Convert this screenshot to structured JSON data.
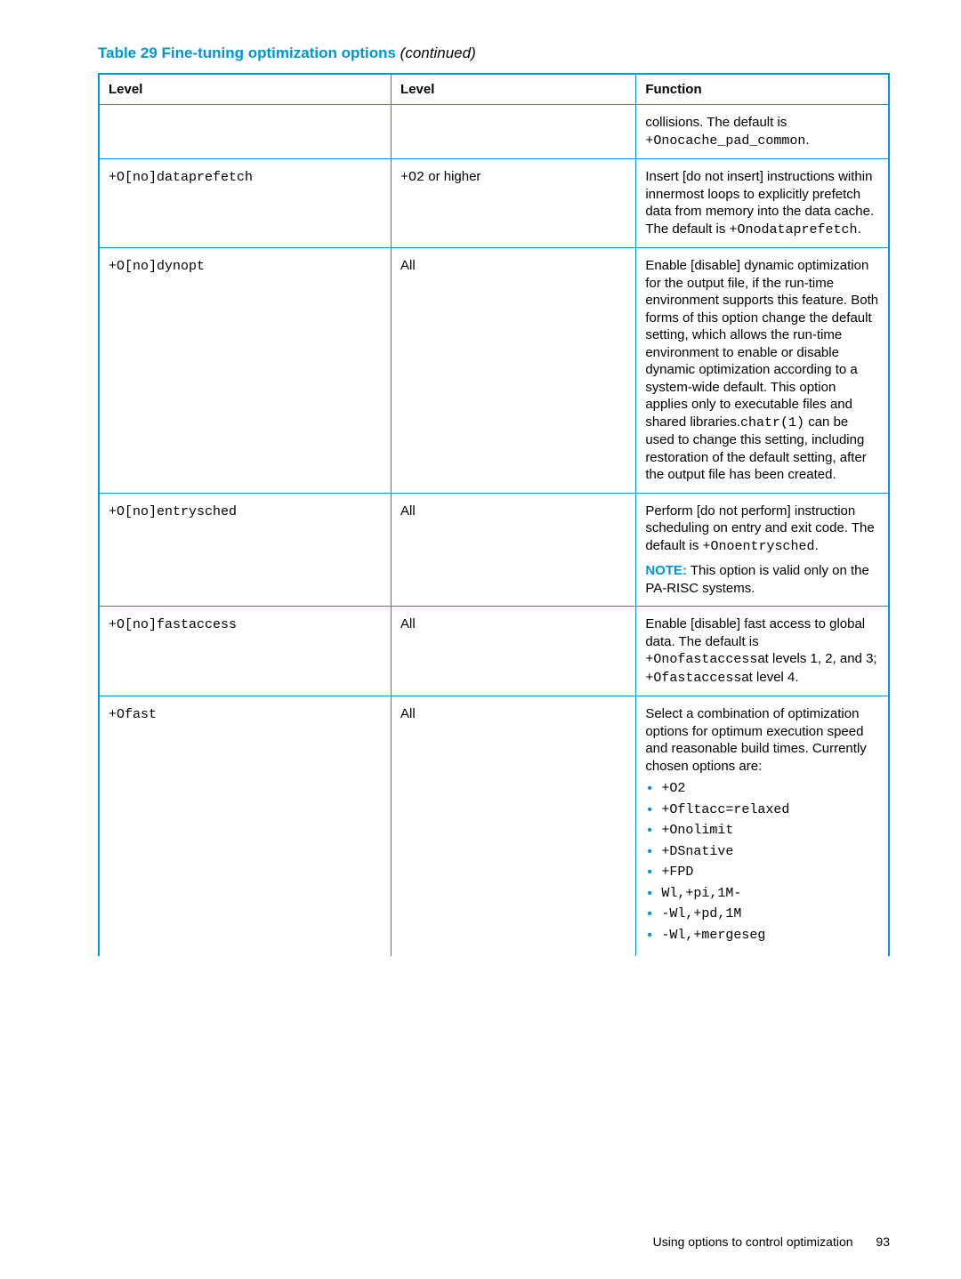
{
  "caption": {
    "prefix": "Table 29 Fine-tuning optimization options",
    "suffix": " (continued)"
  },
  "headers": {
    "c1": "Level",
    "c2": "Level",
    "c3": "Function"
  },
  "rows": {
    "r0": {
      "col1": "",
      "col2": "",
      "col3_a": "collisions. The default is ",
      "col3_code": "+Onocache_pad_common",
      "col3_b": "."
    },
    "r1": {
      "col1": "+O[no]dataprefetch",
      "col2_a": "+O2",
      "col2_b": " or higher",
      "col3_a": "Insert [do not insert] instructions within innermost loops to explicitly prefetch data from memory into the data cache. The default is ",
      "col3_code": "+Onodataprefetch",
      "col3_b": "."
    },
    "r2": {
      "col1": "+O[no]dynopt",
      "col2": "All",
      "col3_a": "Enable [disable] dynamic optimization for the output file, if the run-time environment supports this feature. Both forms of this option change the default setting, which allows the run-time environment to enable or disable dynamic optimization according to a system-wide default. This option applies only to executable files and shared libraries.",
      "col3_code": "chatr(1)",
      "col3_b": " can be used to change this setting, including restoration of the default setting, after the output file has been created."
    },
    "r3": {
      "col1": "+O[no]entrysched",
      "col2": "All",
      "col3_a": "Perform [do not perform] instruction scheduling on entry and exit code. The default is ",
      "col3_code": "+Onoentrysched",
      "col3_b": ".",
      "note_label": "NOTE:",
      "note_text": " This option is valid only on the PA-RISC systems."
    },
    "r4": {
      "col1": "+O[no]fastaccess",
      "col2": "All",
      "col3_a": "Enable [disable] fast access to global data. The default is ",
      "col3_code1": "+Onofastaccess",
      "col3_mid": "at levels 1, 2, and 3; ",
      "col3_code2": "+Ofastaccess",
      "col3_b": "at level 4."
    },
    "r5": {
      "col1": "+Ofast",
      "col2": "All",
      "col3_intro": "Select a combination of optimization options for optimum execution speed and reasonable build times. Currently chosen options are:",
      "bullets": {
        "b0": "+O2",
        "b1": "+Ofltacc=relaxed",
        "b2": "+Onolimit",
        "b3": "+DSnative",
        "b4": "+FPD",
        "b5": "Wl,+pi,1M-",
        "b6": "-Wl,+pd,1M",
        "b7": "-Wl,+mergeseg"
      }
    }
  },
  "footer": {
    "text": "Using options to control optimization",
    "page": "93"
  }
}
